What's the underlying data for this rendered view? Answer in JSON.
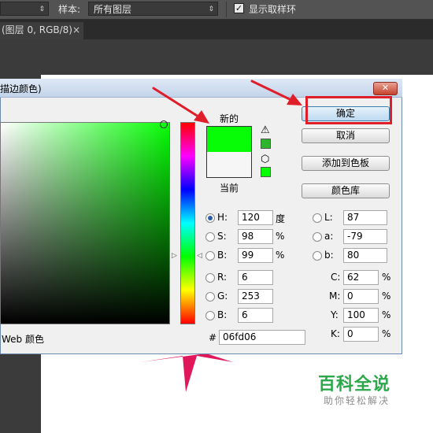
{
  "toolbar": {
    "sample_label": "样本:",
    "sample_value": "所有图层",
    "show_ring_label": "显示取样环",
    "show_ring_checked": "✓"
  },
  "document_tab": {
    "label": "(图层 0, RGB/8)",
    "close": "×"
  },
  "dialog": {
    "title": "描边颜色)",
    "close_glyph": "✕",
    "new_label": "新的",
    "current_label": "当前",
    "new_color": "#06fd06",
    "current_color": "#f6f6f6",
    "web_only_label": "Web 颜色",
    "buttons": {
      "ok": "确定",
      "cancel": "取消",
      "add_swatch": "添加到色板",
      "libraries": "颜色库"
    },
    "hsb": [
      {
        "label": "H:",
        "value": "120",
        "unit": "度",
        "selected": true
      },
      {
        "label": "S:",
        "value": "98",
        "unit": "%",
        "selected": false
      },
      {
        "label": "B:",
        "value": "99",
        "unit": "%",
        "selected": false
      }
    ],
    "rgb": [
      {
        "label": "R:",
        "value": "6"
      },
      {
        "label": "G:",
        "value": "253"
      },
      {
        "label": "B:",
        "value": "6"
      }
    ],
    "lab": [
      {
        "label": "L:",
        "value": "87"
      },
      {
        "label": "a:",
        "value": "-79"
      },
      {
        "label": "b:",
        "value": "80"
      }
    ],
    "cmyk": [
      {
        "label": "C:",
        "value": "62",
        "unit": "%"
      },
      {
        "label": "M:",
        "value": "0",
        "unit": "%"
      },
      {
        "label": "Y:",
        "value": "100",
        "unit": "%"
      },
      {
        "label": "K:",
        "value": "0",
        "unit": "%"
      }
    ],
    "hex_label": "#",
    "hex_value": "06fd06"
  },
  "watermark": {
    "title": "百科全说",
    "subtitle": "助你轻松解决"
  },
  "colors": {
    "annotation_red": "#e01e2a",
    "star_pink": "#e0185a"
  }
}
